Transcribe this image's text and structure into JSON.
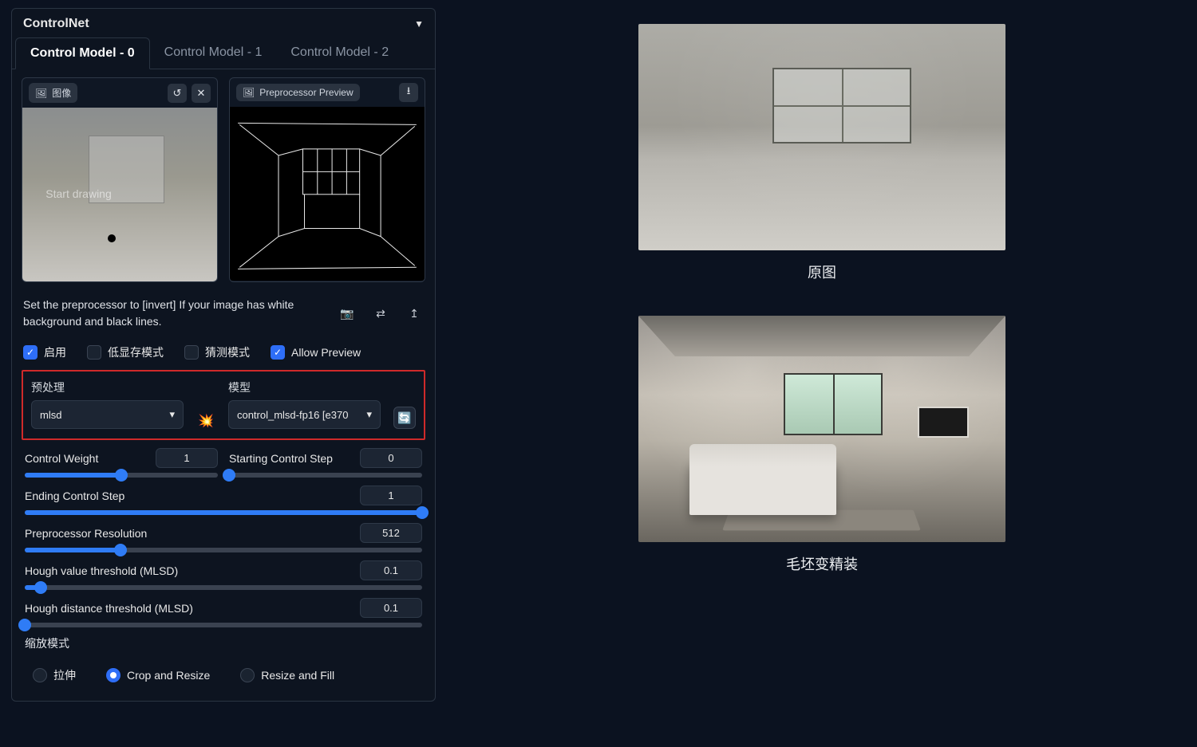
{
  "panel": {
    "title": "ControlNet"
  },
  "tabs": [
    "Control Model - 0",
    "Control Model - 1",
    "Control Model - 2"
  ],
  "active_tab": 0,
  "image_box": {
    "label": "图像",
    "watermark": "Start drawing"
  },
  "preview_box": {
    "label": "Preprocessor Preview"
  },
  "hint": "Set the preprocessor to [invert] If your image has white background and black lines.",
  "checks": {
    "enable": {
      "label": "启用",
      "checked": true
    },
    "lowvram": {
      "label": "低显存模式",
      "checked": false
    },
    "guess": {
      "label": "猜测模式",
      "checked": false
    },
    "preview": {
      "label": "Allow Preview",
      "checked": true
    }
  },
  "preproc": {
    "label": "预处理",
    "value": "mlsd",
    "model_label": "模型",
    "model_value": "control_mlsd-fp16 [e370"
  },
  "sliders": {
    "weight": {
      "label": "Control Weight",
      "value": "1",
      "pct": 50
    },
    "start": {
      "label": "Starting Control Step",
      "value": "0",
      "pct": 0
    },
    "end": {
      "label": "Ending Control Step",
      "value": "1",
      "pct": 100
    },
    "res": {
      "label": "Preprocessor Resolution",
      "value": "512",
      "pct": 24
    },
    "hough_v": {
      "label": "Hough value threshold (MLSD)",
      "value": "0.1",
      "pct": 4
    },
    "hough_d": {
      "label": "Hough distance threshold (MLSD)",
      "value": "0.1",
      "pct": 0
    }
  },
  "resize": {
    "label": "缩放模式",
    "options": [
      "拉伸",
      "Crop and Resize",
      "Resize and Fill"
    ],
    "selected": 1
  },
  "results": {
    "original_caption": "原图",
    "finished_caption": "毛坯变精装"
  }
}
